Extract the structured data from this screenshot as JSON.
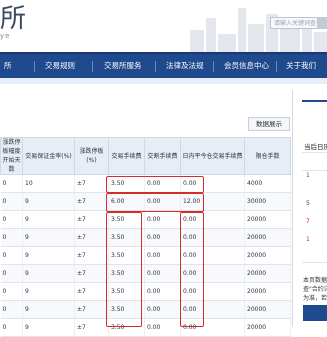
{
  "header": {
    "logo_char": "所",
    "logo_sub": "ye",
    "search_placeholder": "请输入关键词查询"
  },
  "nav": {
    "items": [
      "所",
      "交易规则",
      "交易所服务",
      "法律及法规",
      "会员信息中心",
      "信息中心",
      "关于我们"
    ]
  },
  "main": {
    "tag_label": "数据展示"
  },
  "table": {
    "headers": [
      "涨跌停板幅度开始天数",
      "交易保证金率(%)",
      "涨跌停板(%)",
      "交易手续费",
      "交割手续费",
      "日内平今仓交易手续费",
      "限仓手数"
    ],
    "rows": [
      [
        "0",
        "10",
        "±7",
        "3.50",
        "0.00",
        "0.00",
        "4000"
      ],
      [
        "0",
        "9",
        "±7",
        "6.00",
        "0.00",
        "12.00",
        "30000"
      ],
      [
        "0",
        "9",
        "±7",
        "3.50",
        "0.00",
        "0.00",
        "20000"
      ],
      [
        "0",
        "9",
        "±7",
        "3.50",
        "0.00",
        "0.00",
        "20000"
      ],
      [
        "0",
        "9",
        "±7",
        "3.50",
        "0.00",
        "0.00",
        "20000"
      ],
      [
        "0",
        "9",
        "±7",
        "3.50",
        "0.00",
        "0.00",
        "20000"
      ],
      [
        "0",
        "9",
        "±7",
        "3.50",
        "0.00",
        "0.00",
        "20000"
      ],
      [
        "0",
        "9",
        "±7",
        "3.50",
        "0.00",
        "0.00",
        "20000"
      ],
      [
        "0",
        "9",
        "±7",
        "3.50",
        "0.00",
        "0.00",
        "20000"
      ]
    ]
  },
  "sidebar": {
    "title": "当后日历",
    "numbers": [
      "1",
      "5",
      "7",
      "1"
    ],
    "note_lines": [
      "本页数据仅供",
      "查\"合约详情\"",
      "为准，若"
    ]
  },
  "colors": {
    "nav_bg": "#1f4a8d",
    "highlight": "#d62b2b",
    "header_bg": "#e7edf6"
  }
}
